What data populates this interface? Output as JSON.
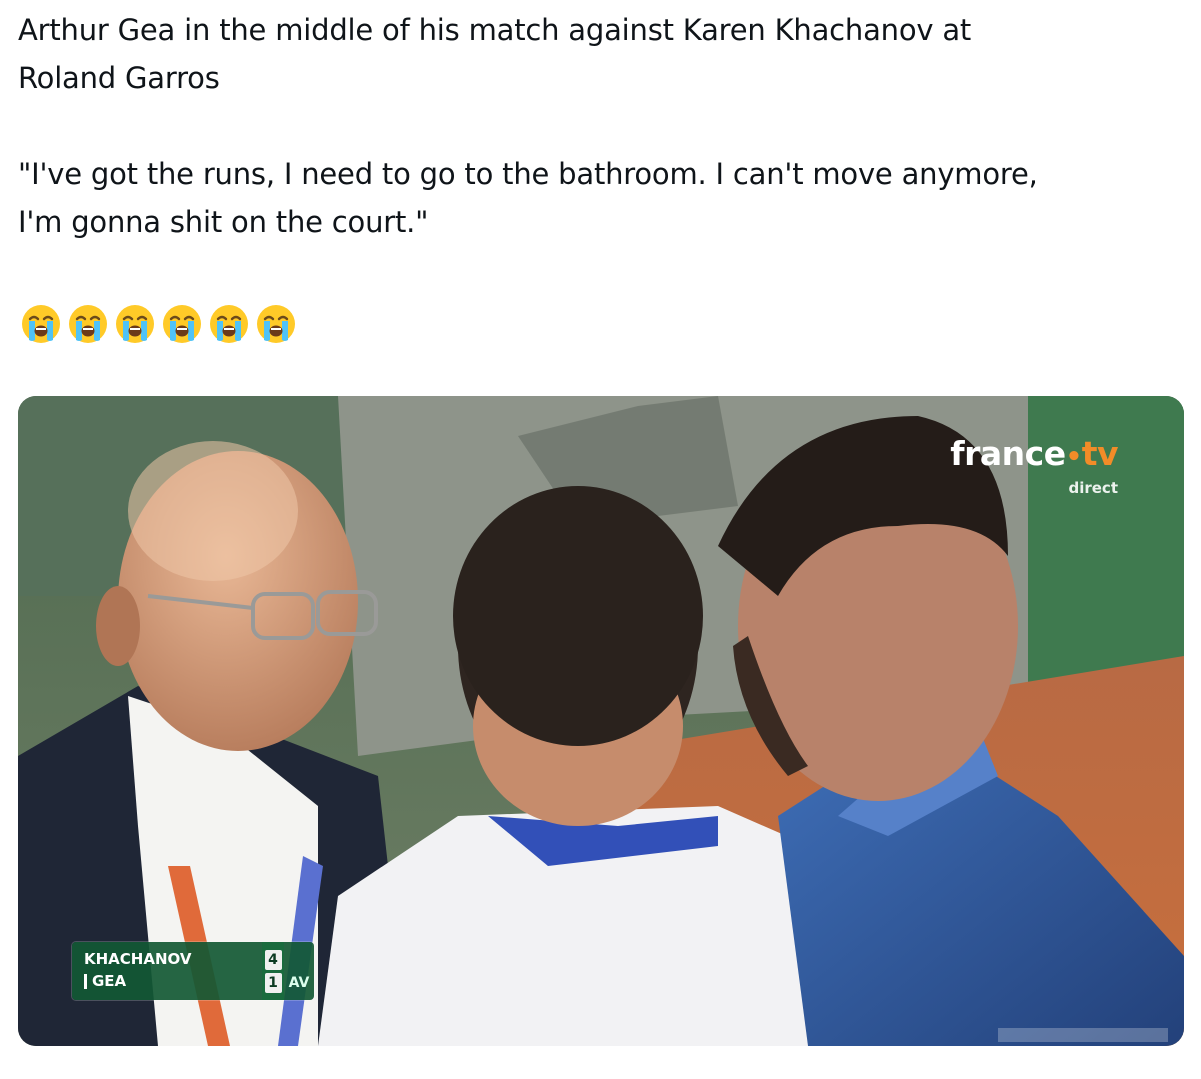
{
  "tweet": {
    "line1": "Arthur Gea in the middle of his match against Karen Khachanov at",
    "line2": "Roland Garros",
    "line3": "\"I've got the runs, I need to go to the bathroom. I can't move anymore,",
    "line4": "I'm gonna shit on the court.\""
  },
  "emojis": [
    "loudly-crying-face",
    "loudly-crying-face",
    "loudly-crying-face",
    "loudly-crying-face",
    "loudly-crying-face",
    "loudly-crying-face"
  ],
  "broadcast": {
    "brand_name": "france",
    "brand_dot": "•",
    "brand_tv": "tv",
    "brand_sub": "direct",
    "scoreboard": {
      "player1": "KHACHANOV",
      "player2": "GEA",
      "player1_set": "4",
      "player2_set": "1",
      "game_score": "AV"
    }
  },
  "colors": {
    "text": "#0f1419",
    "scoreboard_green": "#125834",
    "brand_orange": "#f28c28",
    "clay": "#c4663a",
    "shirt_blue": "#3a62a8"
  }
}
